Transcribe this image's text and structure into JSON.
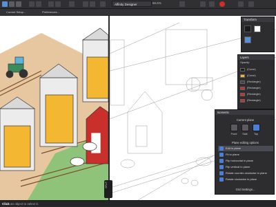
{
  "toolbar": {
    "document_name": "Affinity Designer",
    "zoom": "66.6%",
    "icons": [
      "persona-designer-icon",
      "persona-pixel-icon",
      "persona-export-icon",
      "new-icon",
      "open-icon",
      "grid-icon",
      "snap-icon",
      "isometric-icon",
      "layers-order-icon",
      "align-icon",
      "boolean-icon",
      "view-mode-icon",
      "colour-icon",
      "brush-icon"
    ]
  },
  "context_bar": {
    "current_setup_label": "Current Setup...",
    "preferences_label": "Preferences..."
  },
  "transform_panel": {
    "title": "Transform"
  },
  "layers_panel": {
    "title": "Layers",
    "opacity_label": "Opacity:",
    "items": [
      "(Curve)",
      "(Curve)",
      "(Rectangle)",
      "(Rectangle)",
      "(Rectangle)",
      "(Rectangle)"
    ]
  },
  "isometric_panel": {
    "title": "Isometric",
    "current_plane_label": "Current plane",
    "planes": [
      "Front",
      "Side",
      "Top"
    ],
    "plane_editing_label": "Plane editing options",
    "options": [
      "Edit in plane",
      "Fit to plane",
      "Flip horizontal in plane",
      "Flip vertical in plane",
      "Rotate counter-clockwise in plane",
      "Rotate clockwise in plane"
    ],
    "grid_settings_label": "Grid Settings..."
  },
  "split_view": {
    "label": "SPLIT"
  },
  "status": {
    "bold": "Click",
    "text": " an object to select it."
  },
  "colors": {
    "accent": "#4a7fd4",
    "silo_yellow": "#f4b731",
    "barn_red": "#c9302c",
    "grass": "#8fc37a",
    "ground": "#e7c7a0"
  }
}
